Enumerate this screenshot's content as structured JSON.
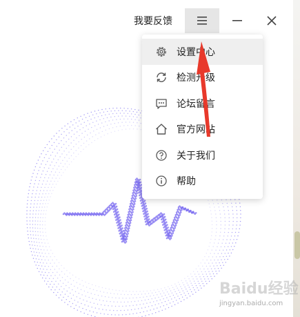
{
  "titlebar": {
    "feedback_label": "我要反馈",
    "menu_icon": "hamburger-icon",
    "minimize_icon": "minimize-icon",
    "close_icon": "close-icon"
  },
  "menu": {
    "items": [
      {
        "label": "设置中心",
        "icon": "gear-icon",
        "active": true
      },
      {
        "label": "检测升级",
        "icon": "refresh-icon"
      },
      {
        "label": "论坛留言",
        "icon": "chat-icon"
      },
      {
        "label": "官方网站",
        "icon": "home-icon"
      },
      {
        "label": "关于我们",
        "icon": "question-icon"
      },
      {
        "label": "帮助",
        "icon": "info-icon"
      }
    ]
  },
  "colors": {
    "accent": "#7b6cf0",
    "arrow": "#e8392b",
    "menu_active_bg": "#efefef",
    "button_active_bg": "#e6e6e6"
  },
  "watermark": {
    "brand": "Baidu经验",
    "url": "jingyan.baidu.com"
  }
}
